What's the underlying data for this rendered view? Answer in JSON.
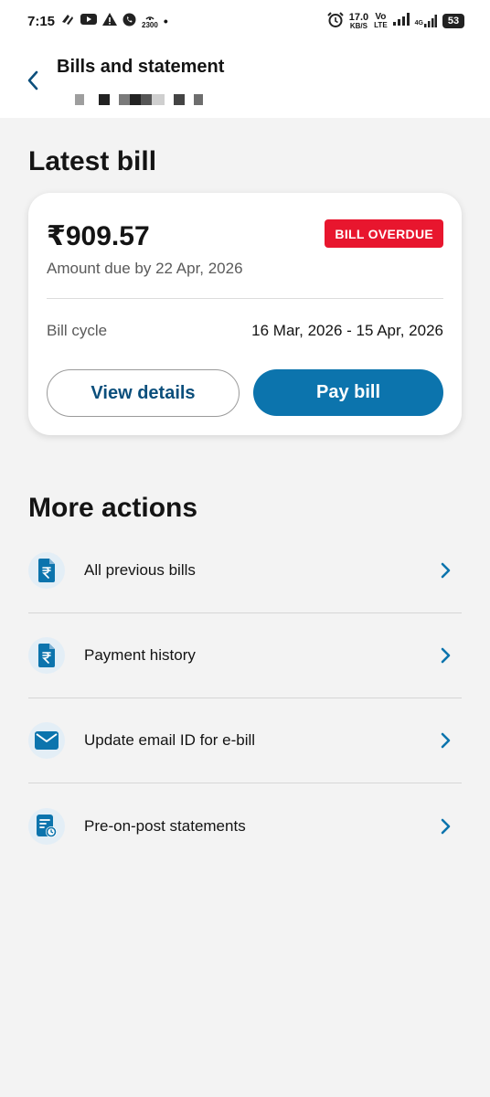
{
  "status_bar": {
    "time": "7:15",
    "left_icons": [
      "network-sync-icon",
      "youtube-icon",
      "warning-icon",
      "whatsapp-icon",
      "hotspot-icon"
    ],
    "hotspot_count": "2300",
    "speed_value": "17.0",
    "speed_unit": "KB/S",
    "volte_top": "Vo",
    "volte_bottom": "LTE",
    "network_label": "4G",
    "battery": "53"
  },
  "header": {
    "title": "Bills and statement",
    "back_icon": "chevron-left-icon"
  },
  "latest_bill": {
    "section_title": "Latest bill",
    "amount": "₹909.57",
    "badge": "BILL OVERDUE",
    "due_text": "Amount due by 22 Apr, 2026",
    "cycle_label": "Bill cycle",
    "cycle_value": "16 Mar, 2026 - 15 Apr, 2026",
    "view_details_label": "View details",
    "pay_bill_label": "Pay bill"
  },
  "more_actions": {
    "section_title": "More actions",
    "items": [
      {
        "label": "All previous bills",
        "icon": "rupee-document-icon"
      },
      {
        "label": "Payment history",
        "icon": "rupee-document-icon"
      },
      {
        "label": "Update email ID for e-bill",
        "icon": "envelope-icon"
      },
      {
        "label": "Pre-on-post statements",
        "icon": "statement-clock-icon"
      }
    ]
  },
  "colors": {
    "primary": "#0c74ad",
    "primary_text": "#0b4f7c",
    "badge": "#e8162e",
    "background": "#f3f3f3",
    "icon_bg": "#e3eef6"
  }
}
